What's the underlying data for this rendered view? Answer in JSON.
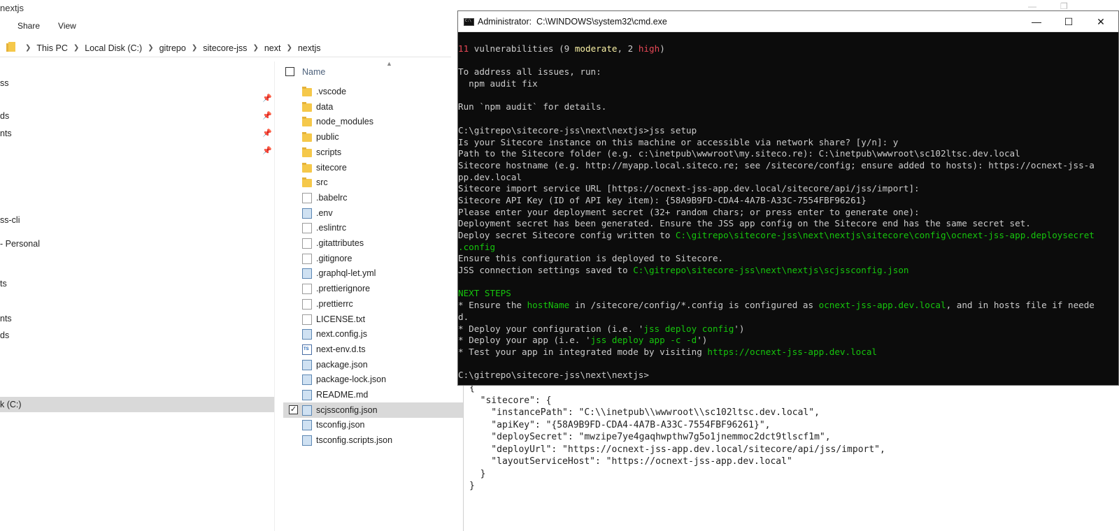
{
  "explorer": {
    "title": "nextjs",
    "ribbon_tabs": [
      "Share",
      "View"
    ],
    "breadcrumb": [
      "This PC",
      "Local Disk (C:)",
      "gitrepo",
      "sitecore-jss",
      "next",
      "nextjs"
    ],
    "nav_items": [
      {
        "label": "ss",
        "pinned": false
      },
      {
        "label": "ds",
        "pinned": true
      },
      {
        "label": "nts",
        "pinned": true
      },
      {
        "label": "ss-cli",
        "pinned": false
      },
      {
        "label": "- Personal",
        "pinned": false
      },
      {
        "label": "ts",
        "pinned": false
      },
      {
        "label": "nts",
        "pinned": false
      },
      {
        "label": "ds",
        "pinned": false
      },
      {
        "label": "k (C:)",
        "pinned": false
      }
    ],
    "column_name": "Name",
    "files": [
      {
        "name": ".vscode",
        "icon": "folder-icon"
      },
      {
        "name": "data",
        "icon": "folder-icon"
      },
      {
        "name": "node_modules",
        "icon": "folder-icon"
      },
      {
        "name": "public",
        "icon": "folder-icon"
      },
      {
        "name": "scripts",
        "icon": "folder-icon"
      },
      {
        "name": "sitecore",
        "icon": "folder-icon"
      },
      {
        "name": "src",
        "icon": "folder-icon"
      },
      {
        "name": ".babelrc",
        "icon": "file-icon"
      },
      {
        "name": ".env",
        "icon": "code-file-icon"
      },
      {
        "name": ".eslintrc",
        "icon": "file-icon"
      },
      {
        "name": ".gitattributes",
        "icon": "text-file-icon"
      },
      {
        "name": ".gitignore",
        "icon": "text-file-icon"
      },
      {
        "name": ".graphql-let.yml",
        "icon": "code-file-icon"
      },
      {
        "name": ".prettierignore",
        "icon": "file-icon"
      },
      {
        "name": ".prettierrc",
        "icon": "file-icon"
      },
      {
        "name": "LICENSE.txt",
        "icon": "text-file-icon"
      },
      {
        "name": "next.config.js",
        "icon": "code-file-icon"
      },
      {
        "name": "next-env.d.ts",
        "icon": "ts-file-icon"
      },
      {
        "name": "package.json",
        "icon": "code-file-icon"
      },
      {
        "name": "package-lock.json",
        "icon": "code-file-icon"
      },
      {
        "name": "README.md",
        "icon": "code-file-icon"
      },
      {
        "name": "scjssconfig.json",
        "icon": "code-file-icon",
        "selected": true,
        "checked": "✓"
      },
      {
        "name": "tsconfig.json",
        "icon": "code-file-icon"
      },
      {
        "name": "tsconfig.scripts.json",
        "icon": "code-file-icon"
      }
    ]
  },
  "cmd": {
    "title": "Administrator:  C:\\WINDOWS\\system32\\cmd.exe",
    "controls": {
      "minimize": "—",
      "maximize": "☐",
      "close": "✕"
    },
    "lines": [
      [
        {
          "t": "11",
          "c": "red"
        },
        {
          "t": " vulnerabilities (9 "
        },
        {
          "t": "moderate",
          "c": "yellow"
        },
        {
          "t": ", 2 "
        },
        {
          "t": "high",
          "c": "red"
        },
        {
          "t": ")"
        }
      ],
      [],
      [
        {
          "t": "To address all issues, run:"
        }
      ],
      [
        {
          "t": "  npm audit fix"
        }
      ],
      [],
      [
        {
          "t": "Run `npm audit` for details."
        }
      ],
      [],
      [
        {
          "t": "C:\\gitrepo\\sitecore-jss\\next\\nextjs>jss setup"
        }
      ],
      [
        {
          "t": "Is your Sitecore instance on this machine or accessible via network share? [y/n]: y"
        }
      ],
      [
        {
          "t": "Path to the Sitecore folder (e.g. c:\\inetpub\\wwwroot\\my.siteco.re): C:\\inetpub\\wwwroot\\sc102ltsc.dev.local"
        }
      ],
      [
        {
          "t": "Sitecore hostname (e.g. http://myapp.local.siteco.re; see /sitecore/config; ensure added to hosts): https://ocnext-jss-a"
        }
      ],
      [
        {
          "t": "pp.dev.local"
        }
      ],
      [
        {
          "t": "Sitecore import service URL [https://ocnext-jss-app.dev.local/sitecore/api/jss/import]:"
        }
      ],
      [
        {
          "t": "Sitecore API Key (ID of API key item): {58A9B9FD-CDA4-4A7B-A33C-7554FBF96261}"
        }
      ],
      [
        {
          "t": "Please enter your deployment secret (32+ random chars; or press enter to generate one):"
        }
      ],
      [
        {
          "t": "Deployment secret has been generated. Ensure the JSS app config on the Sitecore end has the same secret set."
        }
      ],
      [
        {
          "t": "Deploy secret Sitecore config written to "
        },
        {
          "t": "C:\\gitrepo\\sitecore-jss\\next\\nextjs\\sitecore\\config\\ocnext-jss-app.deploysecret",
          "c": "green"
        }
      ],
      [
        {
          "t": ".config",
          "c": "green"
        }
      ],
      [
        {
          "t": "Ensure this configuration is deployed to Sitecore."
        }
      ],
      [
        {
          "t": "JSS connection settings saved to "
        },
        {
          "t": "C:\\gitrepo\\sitecore-jss\\next\\nextjs\\scjssconfig.json",
          "c": "green"
        }
      ],
      [],
      [
        {
          "t": "NEXT STEPS",
          "c": "green"
        }
      ],
      [
        {
          "t": "* Ensure the "
        },
        {
          "t": "hostName",
          "c": "green"
        },
        {
          "t": " in /sitecore/config/*.config is configured as "
        },
        {
          "t": "ocnext-jss-app.dev.local",
          "c": "green"
        },
        {
          "t": ", and in hosts file if neede"
        }
      ],
      [
        {
          "t": "d."
        }
      ],
      [
        {
          "t": "* Deploy your configuration (i.e. '"
        },
        {
          "t": "jss deploy config",
          "c": "green"
        },
        {
          "t": "')"
        }
      ],
      [
        {
          "t": "* Deploy your app (i.e. '"
        },
        {
          "t": "jss deploy app -c -d",
          "c": "green"
        },
        {
          "t": "')"
        }
      ],
      [
        {
          "t": "* Test your app in integrated mode by visiting "
        },
        {
          "t": "https://ocnext-jss-app.dev.local",
          "c": "green"
        }
      ],
      [],
      [
        {
          "t": "C:\\gitrepo\\sitecore-jss\\next\\nextjs>"
        }
      ]
    ]
  },
  "json_document": {
    "content": "{\n  \"sitecore\": {\n    \"instancePath\": \"C:\\\\inetpub\\\\wwwroot\\\\sc102ltsc.dev.local\",\n    \"apiKey\": \"{58A9B9FD-CDA4-4A7B-A33C-7554FBF96261}\",\n    \"deploySecret\": \"mwzipe7ye4gaqhwpthw7g5o1jnemmoc2dct9tlscf1m\",\n    \"deployUrl\": \"https://ocnext-jss-app.dev.local/sitecore/api/jss/import\",\n    \"layoutServiceHost\": \"https://ocnext-jss-app.dev.local\"\n  }\n}"
  },
  "colors": {
    "red": "#e74856",
    "yellow": "#f9f1a5",
    "green": "#16c60c",
    "cmd_bg": "#0c0c0c",
    "cmd_text": "#cccccc",
    "selection": "#d9d9d9"
  }
}
